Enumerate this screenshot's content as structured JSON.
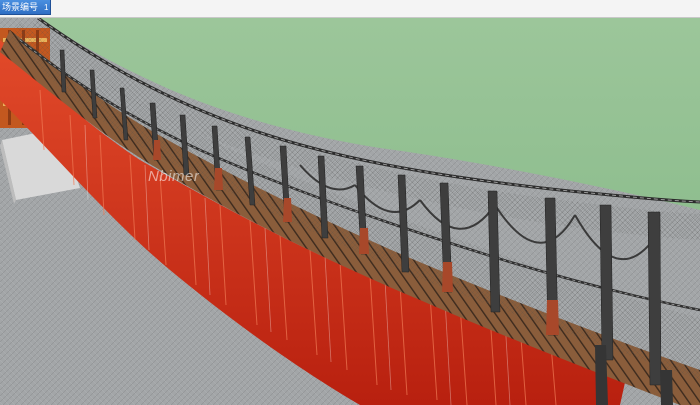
{
  "scene_tab": {
    "label": "场景编号",
    "number": "1"
  },
  "watermark": {
    "text": "Nbimer"
  },
  "colors": {
    "sky": "#95c295",
    "ground": "#9fa2a4",
    "deck_planks": "#8b5e3c",
    "chains": "#3a3a3a",
    "posts": "#4a4a4a",
    "red_fringe": "#d8321c",
    "tab_blue": "#3f83d8"
  },
  "icons": {
    "scene": "3d-model-bridge"
  }
}
